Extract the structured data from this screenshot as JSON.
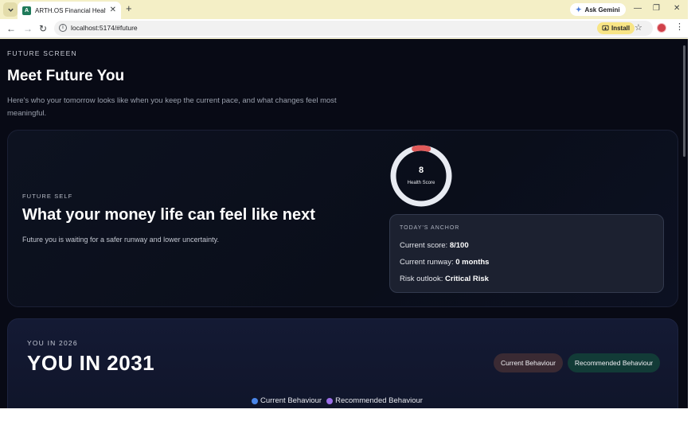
{
  "browser": {
    "tab_title": "ARTH.OS Financial Health Score",
    "favicon_letter": "A",
    "new_tab": "+",
    "gemini_label": "Ask Gemini",
    "url": "localhost:5174/#future",
    "install_label": "Install",
    "controls": {
      "minimize": "—",
      "restore": "❐",
      "close": "✕"
    },
    "nav": {
      "back": "←",
      "forward": "→",
      "reload": "↻"
    }
  },
  "page": {
    "eyebrow": "FUTURE SCREEN",
    "title": "Meet Future You",
    "subtitle": "Here's who your tomorrow looks like when you keep the current pace, and what changes feel most meaningful."
  },
  "future_self": {
    "eyebrow": "FUTURE SELF",
    "title": "What your money life can feel like next",
    "subtitle": "Future you is waiting for a safer runway and lower uncertainty."
  },
  "gauge": {
    "score": "8",
    "label": "Health Score",
    "fraction": 0.08,
    "track_color": "#e8ebf2",
    "progress_color": "#e05a5a"
  },
  "anchor": {
    "eyebrow": "TODAY'S ANCHOR",
    "score_label": "Current score: ",
    "score_value": "8/100",
    "runway_label": "Current runway: ",
    "runway_value": "0 months",
    "risk_label": "Risk outlook: ",
    "risk_value": "Critical Risk"
  },
  "you_in": {
    "eyebrow": "YOU IN 2026",
    "title": "YOU IN 2031",
    "current_button": "Current Behaviour",
    "recommended_button": "Recommended Behaviour"
  },
  "legend": {
    "current": "Current Behaviour",
    "recommended": "Recommended Behaviour",
    "current_color": "#4a86e8",
    "recommended_color": "#9a6ee8"
  }
}
